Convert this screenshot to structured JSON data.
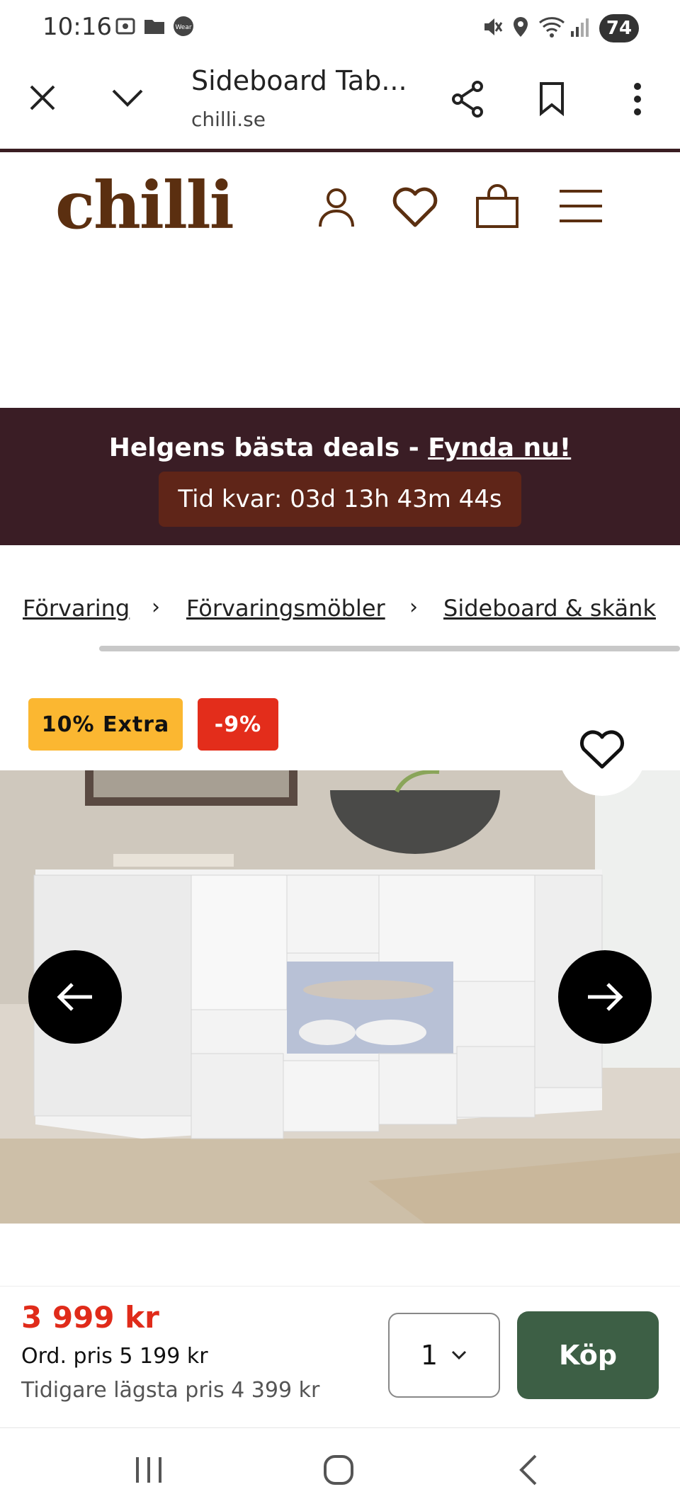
{
  "status_bar": {
    "time": "10:16",
    "battery": "74",
    "icons": [
      "screenshot-icon",
      "folder-icon",
      "wear-icon",
      "mute-icon",
      "location-icon",
      "wifi-icon",
      "signal-icon"
    ]
  },
  "browser": {
    "title": "Sideboard Tab...",
    "url": "chilli.se"
  },
  "site": {
    "logo": "chilli",
    "brand_color": "#5b2f10"
  },
  "promo": {
    "text": "Helgens bästa deals - ",
    "link": "Fynda nu!",
    "timer": "Tid kvar: 03d 13h 43m 44s"
  },
  "breadcrumb": {
    "items": [
      "Förvaring",
      "Förvaringsmöbler",
      "Sideboard & skänk"
    ],
    "separator": "›"
  },
  "badges": {
    "extra": "10% Extra",
    "discount": "-9%"
  },
  "product": {
    "price": "3 999 kr",
    "ordinary_price": "Ord. pris 5 199 kr",
    "lowest_price": "Tidigare lägsta pris 4 399 kr",
    "quantity": "1",
    "buy_label": "Köp"
  },
  "colors": {
    "promo_bg": "#3a1d25",
    "timer_bg": "#5f2518",
    "price": "#e02b1a",
    "buy": "#3d5f45",
    "badge_extra": "#fbb731",
    "badge_discount": "#e32d1b"
  }
}
